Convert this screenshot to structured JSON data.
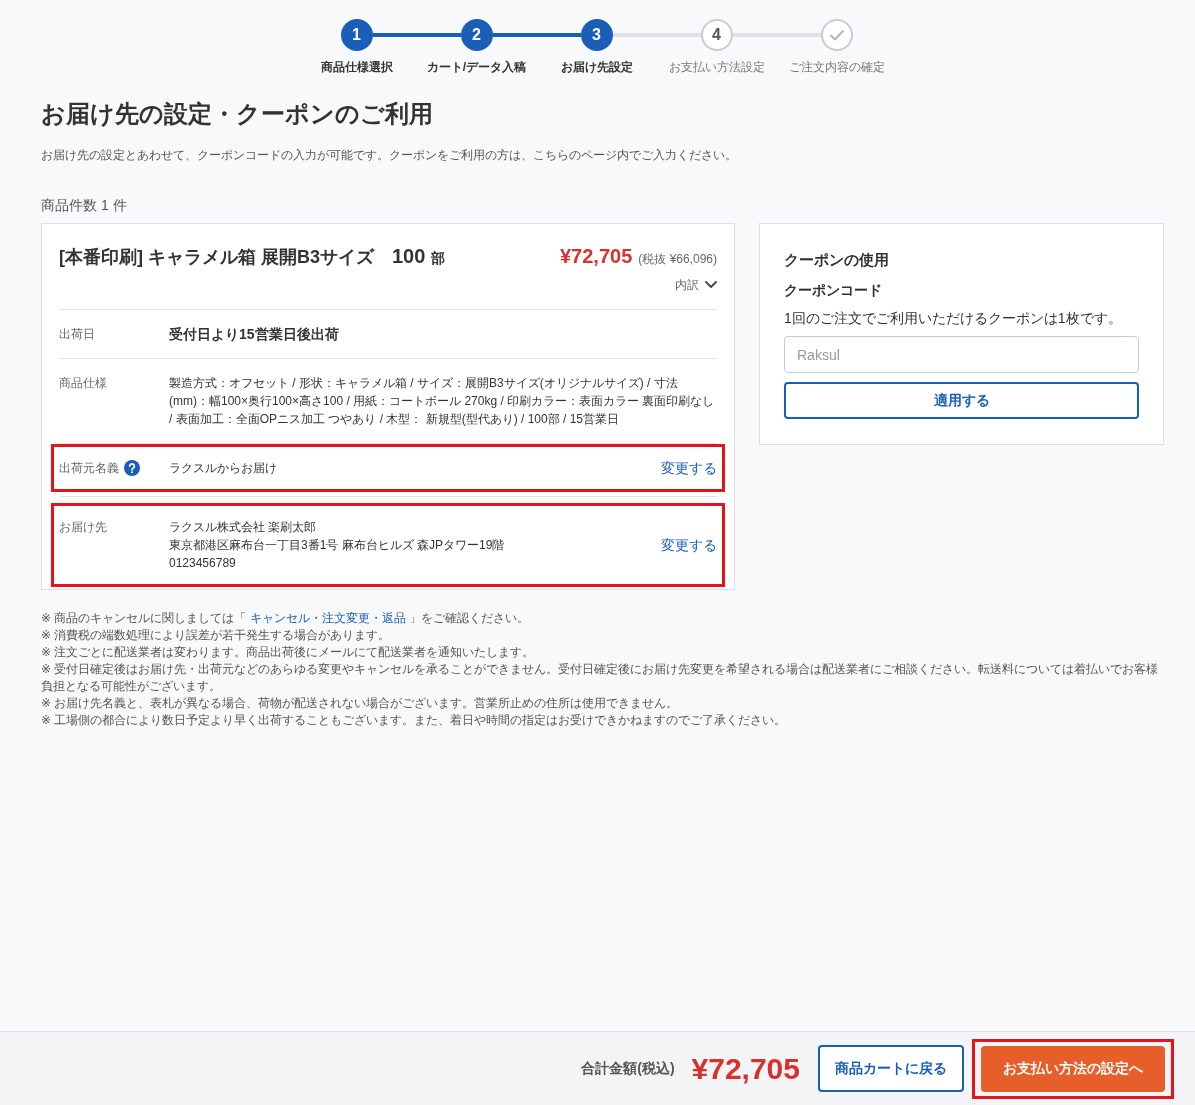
{
  "steps": [
    {
      "kind": "number",
      "number": "1",
      "label": "商品仕様選択",
      "reached": true
    },
    {
      "kind": "number",
      "number": "2",
      "label": "カート/データ入稿",
      "reached": true
    },
    {
      "kind": "number",
      "number": "3",
      "label": "お届け先設定",
      "reached": true
    },
    {
      "kind": "number",
      "number": "4",
      "label": "お支払い方法設定",
      "reached": false
    },
    {
      "kind": "check",
      "label": "ご注文内容の確定",
      "reached": false
    }
  ],
  "page": {
    "title": "お届け先の設定・クーポンのご利用",
    "description": "お届け先の設定とあわせて、クーポンコードの入力が可能です。クーポンをご利用の方は、こちらのページ内でご入力ください。",
    "item_count": "商品件数 1 件"
  },
  "product": {
    "title": "[本番印刷] キャラメル箱 展開B3サイズ",
    "quantity": "100",
    "unit": "部",
    "price": "¥72,705",
    "price_excl_tax": "(税抜 ¥66,096)",
    "breakdown": {
      "label": "内訳",
      "expanded": false
    },
    "details": [
      {
        "kind": "emphasis",
        "label": "出荷日",
        "help": false,
        "lines": [
          "受付日より15営業日後出荷"
        ],
        "highlighted": false
      },
      {
        "kind": "plain",
        "label": "商品仕様",
        "help": false,
        "lines": [
          "製造方式：オフセット / 形状：キャラメル箱 / サイズ：展開B3サイズ(オリジナルサイズ) / 寸法(mm)：幅100×奥行100×高さ100 / 用紙：コートボール 270kg / 印刷カラー：表面カラー 裏面印刷なし / 表面加工：全面OPニス加工 つやあり / 木型： 新規型(型代あり) / 100部 / 15営業日"
        ],
        "highlighted": false
      },
      {
        "kind": "plain",
        "label": "出荷元名義",
        "help": true,
        "lines": [
          "ラクスルからお届け"
        ],
        "action": "変更する",
        "highlighted": true
      },
      {
        "kind": "plain",
        "label": "お届け先",
        "help": false,
        "lines": [
          "ラクスル株式会社 楽刷太郎",
          "東京都港区麻布台一丁目3番1号 麻布台ヒルズ 森JPタワー19階",
          "0123456789"
        ],
        "action": "変更する",
        "highlighted": true
      }
    ]
  },
  "coupon": {
    "title": "クーポンの使用",
    "field_label": "クーポンコード",
    "note": "1回のご注文でご利用いただけるクーポンは1枚です。",
    "placeholder": "Raksul",
    "button": "適用する"
  },
  "notes": [
    {
      "text": "※ 商品のキャンセルに関しましては「 ",
      "link": "キャンセル・注文変更・返品",
      "text_after": " 」をご確認ください。"
    },
    {
      "text": "※ 消費税の端数処理により誤差が若干発生する場合があります。"
    },
    {
      "text": "※ 注文ごとに配送業者は変わります。商品出荷後にメールにて配送業者を通知いたします。"
    },
    {
      "text": "※ 受付日確定後はお届け先・出荷元などのあらゆる変更やキャンセルを承ることができません。受付日確定後にお届け先変更を希望される場合は配送業者にご相談ください。転送料については着払いでお客様負担となる可能性がございます。"
    },
    {
      "text": "※ お届け先名義と、表札が異なる場合、荷物が配送されない場合がございます。営業所止めの住所は使用できません。"
    },
    {
      "text": "※ 工場側の都合により数日予定より早く出荷することもございます。また、着日や時間の指定はお受けできかねますのでご了承ください。"
    }
  ],
  "footer": {
    "total_label": "合計金額(税込)",
    "total": "¥72,705",
    "buttons": [
      {
        "kind": "secondary",
        "label": "商品カートに戻る",
        "highlighted": false
      },
      {
        "kind": "primary",
        "label": "お支払い方法の設定へ",
        "highlighted": true
      }
    ]
  }
}
